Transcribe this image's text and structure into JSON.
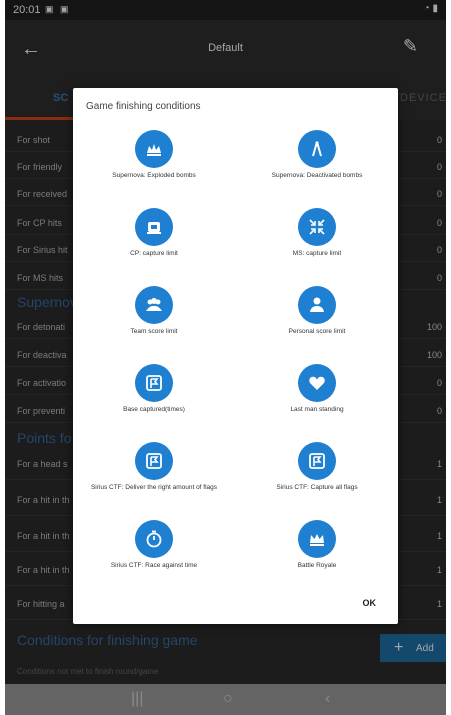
{
  "status_bar": {
    "time": "20:01"
  },
  "app_bar": {
    "title": "Default"
  },
  "tabs": [
    "SC",
    "DEVICES"
  ],
  "rows_top": [
    {
      "label": "For shot",
      "value": "0"
    },
    {
      "label": "For friendly",
      "value": "0"
    },
    {
      "label": "For received",
      "value": "0"
    },
    {
      "label": "For CP hits",
      "value": "0"
    },
    {
      "label": "For Sirius hit",
      "value": "0"
    },
    {
      "label": "For MS hits",
      "value": "0"
    }
  ],
  "section_supernova": "Supernov",
  "rows_supernova": [
    {
      "label": "For detonati",
      "value": "100"
    },
    {
      "label": "For deactiva",
      "value": "100"
    },
    {
      "label": "For activatio",
      "value": "0"
    },
    {
      "label": "For preventi",
      "value": "0"
    }
  ],
  "section_points": "Points fo",
  "rows_points": [
    {
      "label": "For a head s",
      "value": "1"
    },
    {
      "label": "For a hit in th",
      "value": "1"
    },
    {
      "label": "For a hit in th",
      "value": "1"
    },
    {
      "label": "For a hit in th",
      "value": "1"
    },
    {
      "label": "For hitting a",
      "value": "1"
    }
  ],
  "conditions": {
    "title": "Conditions for finishing game",
    "note": "Conditions not met to finish round/game",
    "add_label": "Add"
  },
  "dialog": {
    "title": "Game finishing conditions",
    "ok_label": "OK",
    "options": [
      {
        "label": "Supernova: Exploded bombs",
        "icon": "crown-burst-icon"
      },
      {
        "label": "Supernova: Deactivated bombs",
        "icon": "wire-cutter-icon"
      },
      {
        "label": "CP: capture limit",
        "icon": "cp-device-icon"
      },
      {
        "label": "MS: capture limit",
        "icon": "collapse-arrows-icon"
      },
      {
        "label": "Team score limit",
        "icon": "team-icon"
      },
      {
        "label": "Personal score limit",
        "icon": "person-icon"
      },
      {
        "label": "Base captured(times)",
        "icon": "flag-icon"
      },
      {
        "label": "Last man standing",
        "icon": "heart-icon"
      },
      {
        "label": "Sirius CTF: Deliver the right amount of flags",
        "icon": "flag-icon"
      },
      {
        "label": "Sirius CTF: Capture all flags",
        "icon": "flag-icon"
      },
      {
        "label": "Sirius CTF: Race against time",
        "icon": "stopwatch-icon"
      },
      {
        "label": "Battle Royale",
        "icon": "crown-icon"
      }
    ]
  },
  "colors": {
    "accent_blue": "#1f7fd0",
    "dark_bg": "#2b2b2b",
    "tab_underline": "#d2451e",
    "section_blue": "#3a6aa4"
  }
}
